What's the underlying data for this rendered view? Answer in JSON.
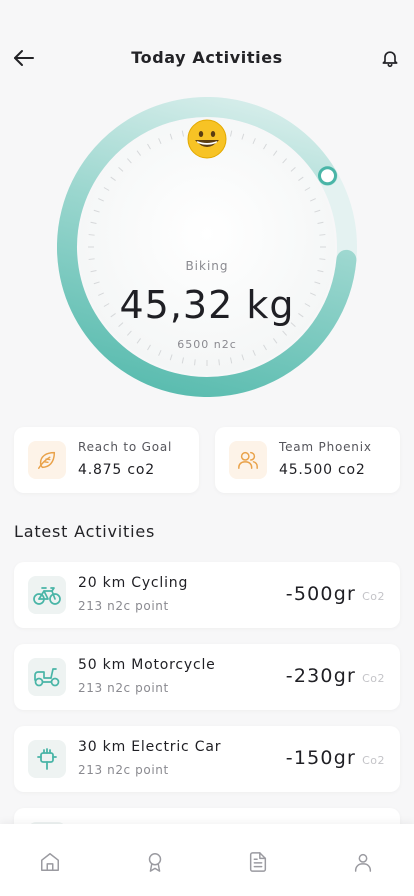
{
  "header": {
    "title": "Today Activities",
    "back_icon": "arrow-left-icon",
    "notification_icon": "bell-icon"
  },
  "gauge": {
    "emoji": "grinning-face-icon",
    "label": "Biking",
    "value": "45,32 kg",
    "subtext": "6500 n2c",
    "progress_fraction": 0.9,
    "color_primary": "#49b5a7",
    "color_track": "#e4f2f1"
  },
  "stats": [
    {
      "icon": "leaf-icon",
      "label": "Reach to Goal",
      "value": "4.875 co2"
    },
    {
      "icon": "users-icon",
      "label": "Team Phoenix",
      "value": "45.500 co2"
    }
  ],
  "activities_section": {
    "title": "Latest Activities",
    "items": [
      {
        "icon": "bicycle-icon",
        "title": "20 km Cycling",
        "subtitle": "213 n2c point",
        "amount": "-500gr",
        "unit": "Co2"
      },
      {
        "icon": "scooter-icon",
        "title": "50 km Motorcycle",
        "subtitle": "213 n2c point",
        "amount": "-230gr",
        "unit": "Co2"
      },
      {
        "icon": "plug-icon",
        "title": "30 km Electric Car",
        "subtitle": "213 n2c point",
        "amount": "-150gr",
        "unit": "Co2"
      }
    ]
  },
  "bottom_nav": {
    "items": [
      {
        "icon": "home-icon"
      },
      {
        "icon": "award-icon"
      },
      {
        "icon": "document-icon"
      },
      {
        "icon": "profile-icon"
      }
    ]
  },
  "colors": {
    "accent": "#49b5a7",
    "warm_accent": "#e9a24a",
    "background": "#f7f7f8",
    "card": "#ffffff"
  }
}
